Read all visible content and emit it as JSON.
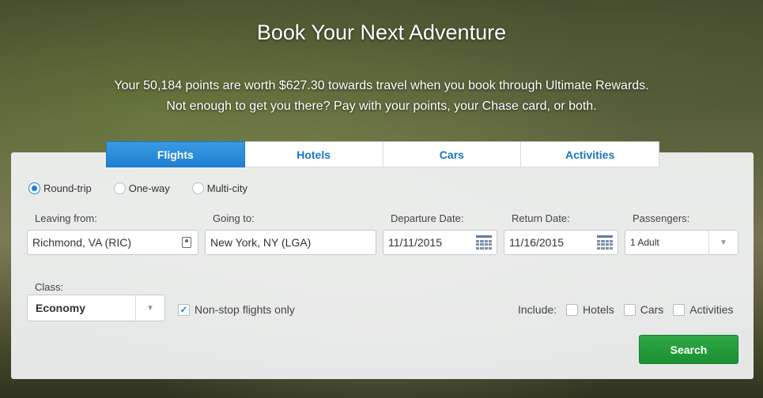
{
  "hero": {
    "title": "Book Your Next Adventure",
    "line1": "Your 50,184 points are worth $627.30 towards travel when you book through Ultimate Rewards.",
    "line2": "Not enough to get you there? Pay with your points, your Chase card, or both."
  },
  "tabs": [
    {
      "label": "Flights",
      "active": true
    },
    {
      "label": "Hotels",
      "active": false
    },
    {
      "label": "Cars",
      "active": false
    },
    {
      "label": "Activities",
      "active": false
    }
  ],
  "trip_type": [
    {
      "label": "Round-trip",
      "checked": true
    },
    {
      "label": "One-way",
      "checked": false
    },
    {
      "label": "Multi-city",
      "checked": false
    }
  ],
  "fields": {
    "leaving_from": {
      "label": "Leaving from:",
      "value": "Richmond, VA (RIC)",
      "icon": "contact-card-icon"
    },
    "going_to": {
      "label": "Going to:",
      "value": "New York, NY (LGA)"
    },
    "departure": {
      "label": "Departure Date:",
      "value": "11/11/2015",
      "icon": "calendar-icon"
    },
    "return": {
      "label": "Return Date:",
      "value": "11/16/2015",
      "icon": "calendar-icon"
    },
    "passengers": {
      "label": "Passengers:",
      "value": "1 Adult"
    },
    "class": {
      "label": "Class:",
      "value": "Economy"
    }
  },
  "nonstop": {
    "label": "Non-stop flights only",
    "checked": true
  },
  "include": {
    "label": "Include:",
    "options": [
      {
        "label": "Hotels",
        "checked": false
      },
      {
        "label": "Cars",
        "checked": false
      },
      {
        "label": "Activities",
        "checked": false
      }
    ]
  },
  "search_label": "Search",
  "colors": {
    "tab_active": "#1e80d0",
    "search_button": "#2ea844",
    "link_blue": "#1a74c6"
  }
}
